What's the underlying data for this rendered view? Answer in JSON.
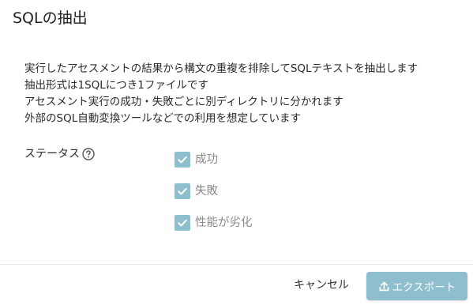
{
  "dialog": {
    "title": "SQLの抽出",
    "description_lines": [
      "実行したアセスメントの結果から構文の重複を排除してSQLテキストを抽出します",
      "抽出形式は1SQLにつき1ファイルです",
      "アセスメント実行の成功・失敗ごとに別ディレクトリに分かれます",
      "外部のSQL自動変換ツールなどでの利用を想定しています"
    ],
    "status": {
      "label": "ステータス",
      "help_icon": "question-circle-icon",
      "options": [
        {
          "label": "成功",
          "checked": true
        },
        {
          "label": "失敗",
          "checked": true
        },
        {
          "label": "性能が劣化",
          "checked": true
        }
      ]
    },
    "footer": {
      "cancel_label": "キャンセル",
      "export_label": "エクスポート",
      "export_icon": "upload-icon"
    }
  },
  "colors": {
    "accent": "#8fbfcf",
    "text": "#333333",
    "muted_text": "#8a8a8a",
    "divider": "#e6e6e6"
  }
}
